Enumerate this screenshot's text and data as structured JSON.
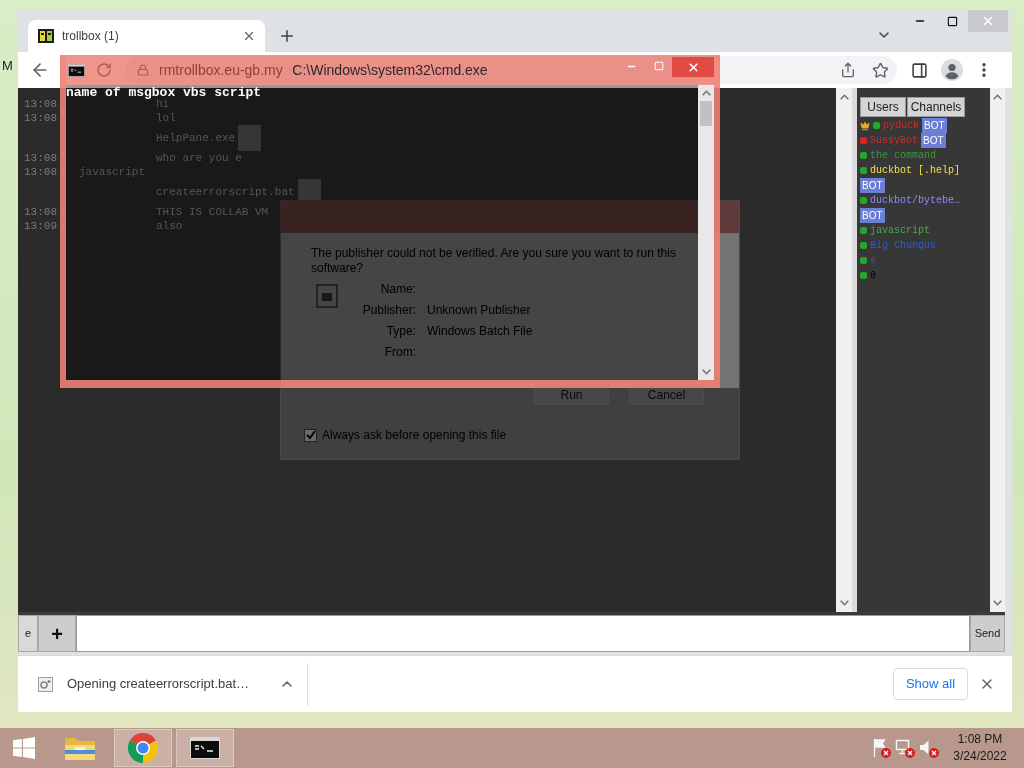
{
  "desktop": {
    "icon_label": "M"
  },
  "browser": {
    "tabs": [
      {
        "title": "trollbox (1)",
        "selected": true
      }
    ],
    "address": {
      "url": "rmtrollbox.eu-gb.my"
    }
  },
  "chat": {
    "lines": [
      {
        "kind": "text",
        "time": "13:08",
        "text": "hi"
      },
      {
        "kind": "text",
        "time": "13:08",
        "text": "lol"
      },
      {
        "kind": "file",
        "text": "HelpPane.exe"
      },
      {
        "kind": "text",
        "time": "13:08",
        "text": "who are you e"
      },
      {
        "kind": "text",
        "time": "13:08",
        "author": "javascript"
      },
      {
        "kind": "file",
        "text": "createerrorscript.bat"
      },
      {
        "kind": "text",
        "time": "13:08",
        "text": "THIS IS COLLAB VM"
      },
      {
        "kind": "text",
        "time": "13:09",
        "text": "also"
      }
    ]
  },
  "sidebar": {
    "tabs": [
      "Users",
      "Channels"
    ],
    "users": [
      {
        "name": "pyduck",
        "color": "#d42a2a",
        "busy": false,
        "crown": true,
        "badge": "BOT"
      },
      {
        "name": "SussyBot",
        "color": "#d42a2a",
        "busy": true,
        "crown": false,
        "badge": "BOT"
      },
      {
        "name": "the command",
        "color": "#3a9a3a",
        "busy": false,
        "crown": false
      },
      {
        "name": "duckbot [.help]",
        "color": "#f2e24a",
        "busy": false,
        "crown": false,
        "badge": "BOT"
      },
      {
        "name": "duckbot/bytebe…",
        "color": "#8a8aff",
        "busy": false,
        "crown": false,
        "badge": "BOT"
      },
      {
        "name": "javascript",
        "color": "#4aaa4a",
        "busy": false,
        "crown": false
      },
      {
        "name": "Big Chungus",
        "color": "#2a5ad8",
        "busy": false,
        "crown": false
      },
      {
        "name": "s",
        "color": "#555555",
        "busy": false,
        "crown": false
      },
      {
        "name": "0",
        "color": "#000000",
        "busy": false,
        "crown": false
      }
    ]
  },
  "composer": {
    "menu_button": "e",
    "add_button": "+",
    "send_button": "Send"
  },
  "download_bar": {
    "item": "Opening createerrorscript.bat…",
    "show_all": "Show all"
  },
  "security_dialog": {
    "message": "The publisher could not be verified. Are you sure you want to run this software?",
    "fields": [
      {
        "label": "Name:"
      },
      {
        "label": "Publisher:",
        "value": "Unknown Publisher"
      },
      {
        "label": "Type:",
        "value": "Windows Batch File"
      },
      {
        "label": "From:"
      }
    ],
    "buttons": [
      "Run",
      "Cancel"
    ],
    "checkbox": {
      "label": "Always ask before opening this file",
      "checked": true
    }
  },
  "cmd_window": {
    "title": "C:\\Windows\\system32\\cmd.exe",
    "lines": [
      "name of msgbox vbs script"
    ]
  },
  "taskbar": {
    "apps": [
      {
        "kind": "explorer",
        "active": false
      },
      {
        "kind": "chrome",
        "active": true
      },
      {
        "kind": "terminal",
        "active": true
      }
    ],
    "time": "1:08 PM",
    "date": "3/24/2022"
  }
}
